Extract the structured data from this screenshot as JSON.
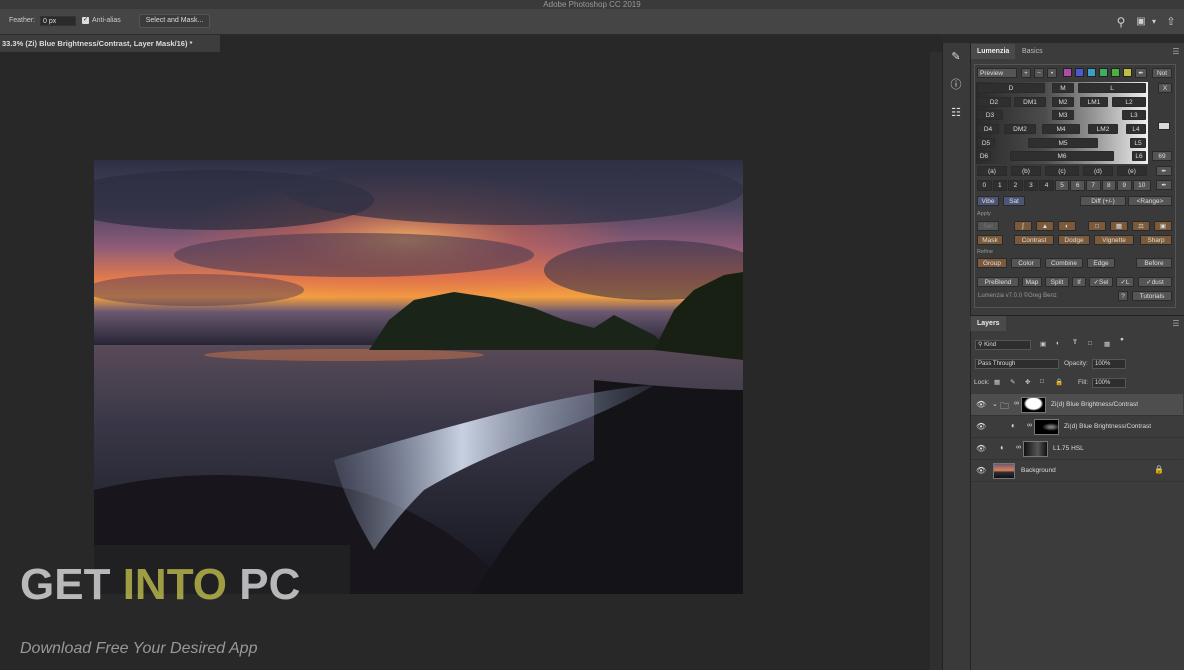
{
  "window": {
    "title": "Adobe Photoshop CC 2019"
  },
  "options_bar": {
    "feather_label": "Feather:",
    "feather_value": "0 px",
    "anti_alias_label": "Anti-alias",
    "select_mask_label": "Select and Mask..."
  },
  "document": {
    "tab_title": "33.3% (Zi) Blue Brightness/Contrast, Layer Mask/16) *"
  },
  "watermark": {
    "title_get": "GET ",
    "title_into": "INTO",
    "title_pc": " PC",
    "subtitle": "Download Free Your Desired App"
  },
  "right_panel": {
    "tabs": [
      "Lumenzia",
      "Basics"
    ],
    "lumenzia": {
      "preview": "Preview",
      "not": "Not",
      "x": "X",
      "num_69": "69",
      "rows": [
        [
          "D",
          "M",
          "L"
        ],
        [
          "D2",
          "DM1",
          "M2",
          "LM1",
          "L2"
        ],
        [
          "D3",
          "M3",
          "L3"
        ],
        [
          "D4",
          "DM2",
          "M4",
          "LM2",
          "L4"
        ],
        [
          "D5",
          "M5",
          "L5"
        ],
        [
          "D6",
          "M6",
          "L6"
        ]
      ],
      "zone_buttons": [
        "(a)",
        "(b)",
        "(c)",
        "(d)",
        "(e)"
      ],
      "numbers": [
        "0",
        "1",
        "2",
        "3",
        "4",
        "5",
        "6",
        "7",
        "8",
        "9",
        "10"
      ],
      "vibe": "Vibe",
      "sat": "Sat",
      "diff": "Diff (+/-)",
      "range": "<Range>",
      "apply_label": "Apply",
      "sel": "Sel",
      "apply_buttons": [
        "Mask",
        "Contrast",
        "Dodge",
        "Vignette",
        "Sharp"
      ],
      "refine_label": "Refine",
      "refine_buttons": [
        "Group",
        "Color",
        "Combine",
        "Edge",
        "Before"
      ],
      "bottom_buttons": [
        "PreBlend",
        "Map",
        "Split",
        "If",
        "✓Sel",
        "✓L",
        "✓dust"
      ],
      "footer": "Lumenzia v7.0.0 ©Greg Benz",
      "help": "?",
      "tutorials": "Tutorials",
      "swatch_colors": [
        "#b24aa8",
        "#4a5bd0",
        "#3aa0c8",
        "#3ab060",
        "#4ab040",
        "#c0c040",
        "#c04040"
      ]
    },
    "layers": {
      "tab": "Layers",
      "kind": "Kind",
      "blend_mode": "Pass Through",
      "opacity_label": "Opacity:",
      "opacity_value": "100%",
      "lock_label": "Lock:",
      "fill_label": "Fill:",
      "fill_value": "100%",
      "items": [
        {
          "name": "Zi(d) Blue Brightness/Contrast"
        },
        {
          "name": "Zi(d) Blue Brightness/Contrast"
        },
        {
          "name": "L1.75 HSL"
        },
        {
          "name": "Background"
        }
      ]
    }
  }
}
